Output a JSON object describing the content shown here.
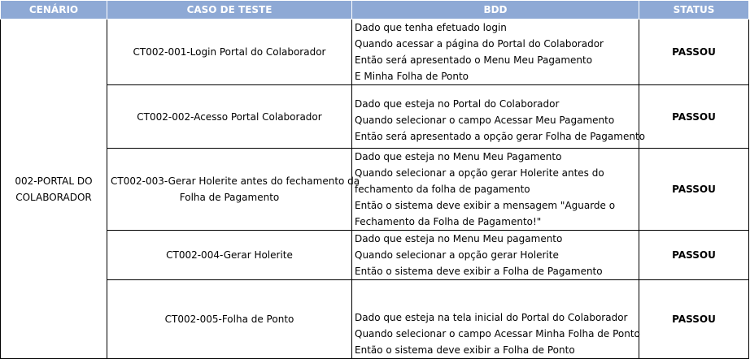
{
  "headers": {
    "cenario": "CENÁRIO",
    "caso_de_teste": "CASO DE TESTE",
    "bdd": "BDD",
    "status": "STATUS"
  },
  "scenario": {
    "line1": "002-PORTAL DO",
    "line2": "COLABORADOR"
  },
  "rows": [
    {
      "case": "CT002-001-Login Portal do Colaborador",
      "bdd": [
        "Dado que tenha efetuado login",
        "Quando acessar a página do Portal do Colaborador",
        "Então será apresentado o Menu Meu Pagamento",
        "E Minha Folha de Ponto"
      ],
      "status": "PASSOU"
    },
    {
      "case": "CT002-002-Acesso Portal Colaborador",
      "bdd": [
        "Dado que esteja no Portal do Colaborador",
        "Quando selecionar o campo Acessar Meu Pagamento",
        "Então será apresentado a opção gerar Folha de Pagamento"
      ],
      "status": "PASSOU"
    },
    {
      "case_line1": "CT002-003-Gerar Holerite antes do fechamento da",
      "case_line2": "Folha de Pagamento",
      "bdd": [
        "Dado que esteja no Menu Meu Pagamento",
        "Quando selecionar a opção gerar Holerite antes do",
        "fechamento da folha de pagamento",
        "Então o sistema deve exibir a mensagem \"Aguarde o",
        "Fechamento da Folha de Pagamento!\""
      ],
      "status": "PASSOU"
    },
    {
      "case": "CT002-004-Gerar Holerite",
      "bdd": [
        "Dado que esteja no Menu Meu pagamento",
        "Quando selecionar a opção gerar Holerite",
        "Então o sistema deve exibir a Folha de Pagamento"
      ],
      "status": "PASSOU"
    },
    {
      "case": "CT002-005-Folha de Ponto",
      "bdd": [
        "Dado que esteja na tela inicial do Portal do Colaborador",
        "Quando selecionar o campo Acessar Minha Folha de Ponto",
        "Então o sistema deve exibir a Folha de Ponto"
      ],
      "status": "PASSOU"
    }
  ]
}
